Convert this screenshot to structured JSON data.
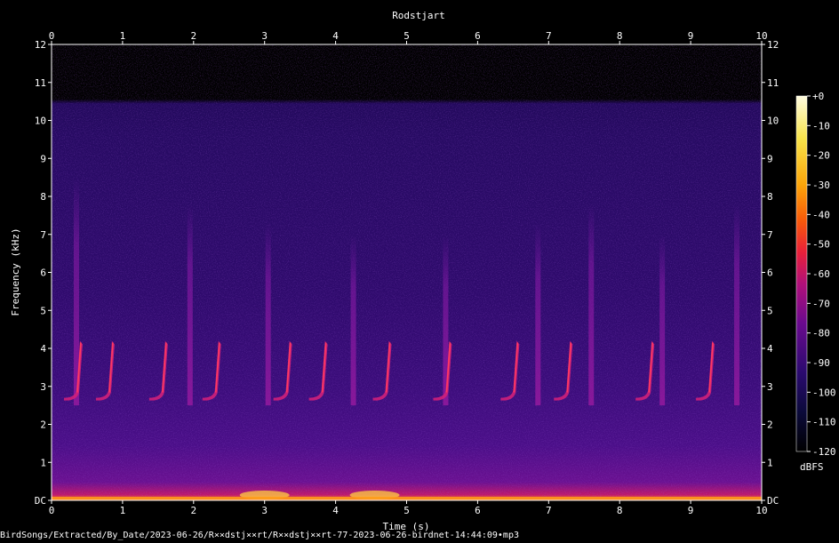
{
  "chart_data": {
    "type": "heatmap",
    "title": "Rodstjart",
    "xlabel": "Time (s)",
    "ylabel": "Frequency (kHz)",
    "xlim": [
      0,
      10
    ],
    "ylim": [
      0,
      12
    ],
    "x_ticks": [
      "0",
      "1",
      "2",
      "3",
      "4",
      "5",
      "6",
      "7",
      "8",
      "9",
      "10"
    ],
    "y_ticks": [
      "DC",
      "1",
      "2",
      "3",
      "4",
      "5",
      "6",
      "7",
      "8",
      "9",
      "10",
      "11",
      "12"
    ],
    "colorbar": {
      "label": "dBFS",
      "ticks": [
        "+0",
        "-10",
        "-20",
        "-30",
        "-40",
        "-50",
        "-60",
        "-70",
        "-80",
        "-90",
        "-100",
        "-110",
        "-120"
      ],
      "range": [
        -120,
        0
      ],
      "colors": [
        "#000000",
        "#0b0a3a",
        "#2a0a6e",
        "#6a0a8e",
        "#b0107a",
        "#e8203a",
        "#f85a0a",
        "#fca50a",
        "#f7e34a",
        "#fffce0"
      ]
    },
    "background_level_dbfs": -95,
    "low_band_level_dbfs": -80,
    "song_notes_time_s": [
      0.35,
      0.8,
      1.55,
      2.3,
      3.3,
      3.8,
      4.7,
      5.55,
      6.5,
      7.25,
      8.4,
      9.25
    ],
    "song_note_freq_khz": [
      2.7,
      4.2
    ],
    "broadband_streaks_time_s": [
      0.35,
      1.95,
      3.05,
      4.25,
      5.55,
      6.85,
      7.6,
      8.6,
      9.65
    ],
    "broadband_streaks_top_khz": [
      8.5,
      7.8,
      7.3,
      7.0,
      7.0,
      7.3,
      7.8,
      7.0,
      7.8
    ],
    "noise_burst_time_s": [
      3.0,
      4.55
    ]
  },
  "footer": "BirdSongs/Extracted/By_Date/2023-06-26/R××dstj××rt/R××dstj××rt-77-2023-06-26-birdnet-14:44:09•mp3"
}
